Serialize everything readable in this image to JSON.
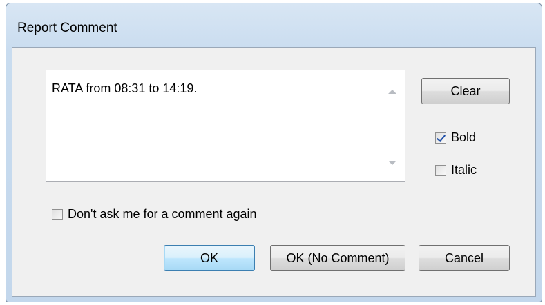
{
  "window": {
    "title": "Report Comment"
  },
  "comment": {
    "text": "RATA from 08:31 to 14:19."
  },
  "buttons": {
    "clear": "Clear",
    "ok": "OK",
    "ok_no_comment": "OK (No Comment)",
    "cancel": "Cancel"
  },
  "options": {
    "bold_label": "Bold",
    "bold_checked": true,
    "italic_label": "Italic",
    "italic_checked": false,
    "dont_ask_label": "Don't ask me for a comment again",
    "dont_ask_checked": false
  }
}
